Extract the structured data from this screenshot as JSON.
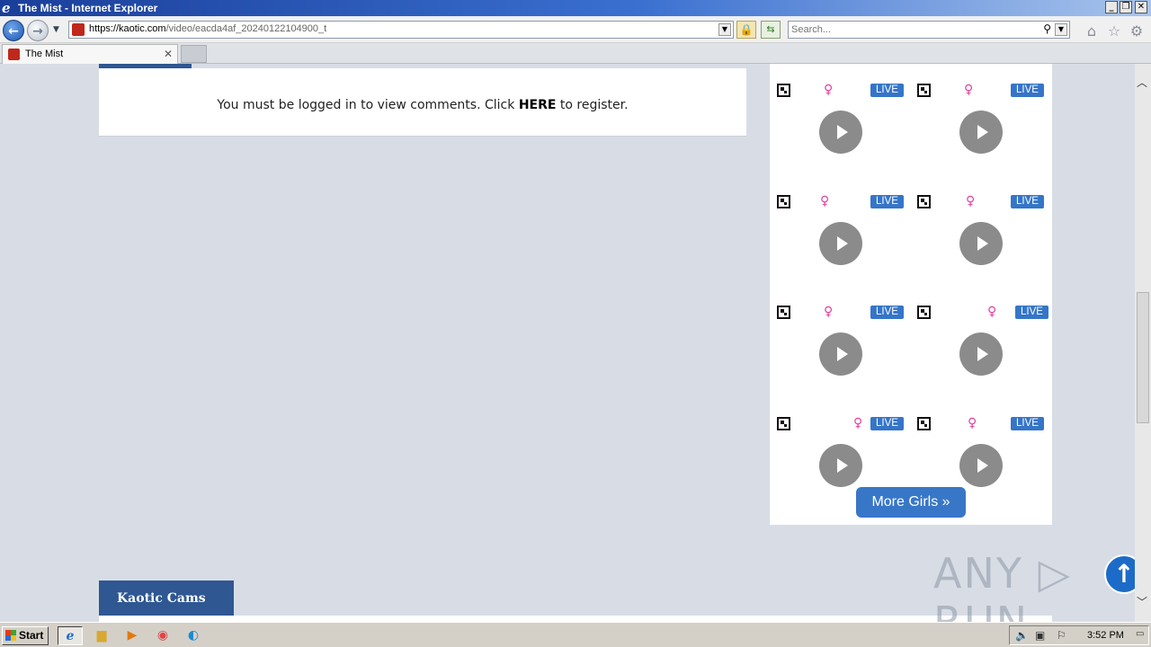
{
  "window": {
    "title": "The Mist - Internet Explorer",
    "ie_icon_glyph": "e"
  },
  "addressbar": {
    "url_host": "https://kaotic.com",
    "url_path": "/video/eacda4af_20240122104900_t",
    "lock_glyph": "🔒",
    "refresh_glyph": "⇆"
  },
  "search": {
    "placeholder": "Search..."
  },
  "tabs": [
    {
      "label": "The Mist"
    }
  ],
  "comments": {
    "prefix": "You must be logged in to view comments. Click ",
    "link": "HERE",
    "suffix": " to register."
  },
  "cams": {
    "badge": "LIVE",
    "gender_glyph": "♀",
    "count": 8,
    "more_label": "More Girls »"
  },
  "section": {
    "kaotic_cams": "Kaotic Cams"
  },
  "watermark": "ANY ▷ RUN",
  "taskbar": {
    "start_label": "Start",
    "clock": "3:52 PM"
  },
  "colors": {
    "live_badge": "#3575c9",
    "nav_blue": "#2f5792",
    "female_symbol": "#e040a0",
    "play_button": "#8b8b8b"
  }
}
